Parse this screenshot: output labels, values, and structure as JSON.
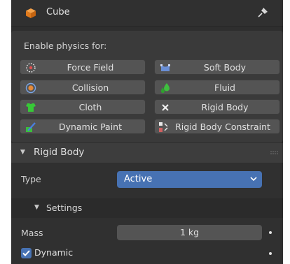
{
  "header": {
    "object_name": "Cube",
    "object_icon": "cube-icon",
    "pin_icon": "pin-icon"
  },
  "physics": {
    "enable_label": "Enable physics for:",
    "buttons": [
      {
        "label": "Force Field",
        "icon": "force-field-icon"
      },
      {
        "label": "Soft Body",
        "icon": "soft-body-icon"
      },
      {
        "label": "Collision",
        "icon": "collision-icon"
      },
      {
        "label": "Fluid",
        "icon": "fluid-icon"
      },
      {
        "label": "Cloth",
        "icon": "cloth-icon"
      },
      {
        "label": "Rigid Body",
        "icon": "close-icon"
      },
      {
        "label": "Dynamic Paint",
        "icon": "dynamic-paint-icon"
      },
      {
        "label": "Rigid Body Constraint",
        "icon": "rigid-body-constraint-icon"
      }
    ]
  },
  "rigid_body": {
    "title": "Rigid Body",
    "type_label": "Type",
    "type_value": "Active",
    "settings": {
      "title": "Settings",
      "mass_label": "Mass",
      "mass_value": "1 kg",
      "dynamic_label": "Dynamic",
      "dynamic_checked": true
    }
  },
  "colors": {
    "accent": "#4772b3",
    "panel_bg": "#2e2e2e",
    "button_bg": "#545454"
  }
}
